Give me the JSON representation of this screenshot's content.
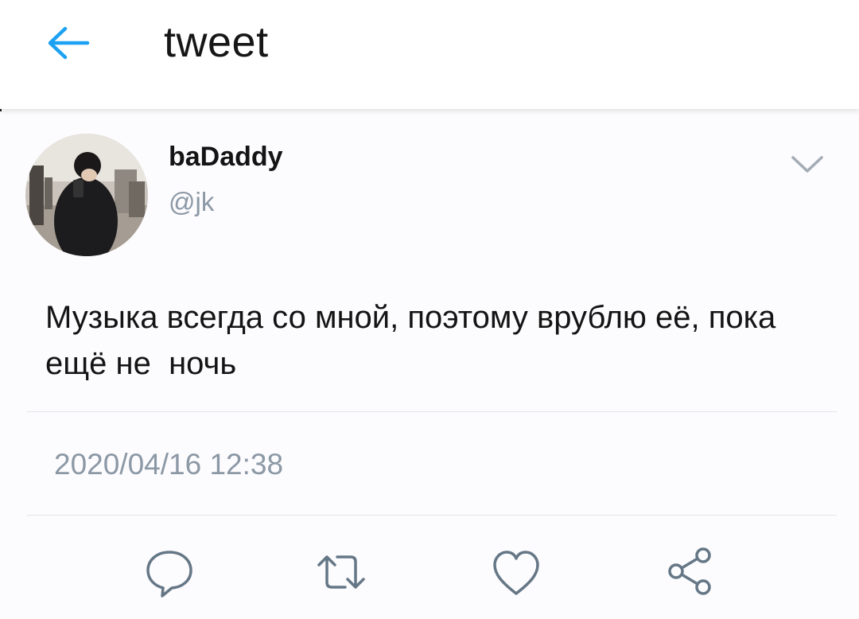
{
  "header": {
    "title": "tweet",
    "back_icon": "arrow-left-icon"
  },
  "tweet": {
    "author_name": "baDaddy",
    "author_handle": "@jk",
    "text": "Музыка всегда со мной, поэтому врублю её, пока ещё не  ночь",
    "timestamp": "2020/04/16 12:38",
    "menu_icon": "chevron-down-icon"
  },
  "actions": [
    {
      "name": "reply",
      "icon": "speech-bubble-icon"
    },
    {
      "name": "retweet",
      "icon": "retweet-icon"
    },
    {
      "name": "like",
      "icon": "heart-icon"
    },
    {
      "name": "share",
      "icon": "share-icon"
    }
  ],
  "colors": {
    "accent": "#1da1f2",
    "muted": "#8b98a5",
    "icon": "#657786",
    "text": "#141414"
  }
}
